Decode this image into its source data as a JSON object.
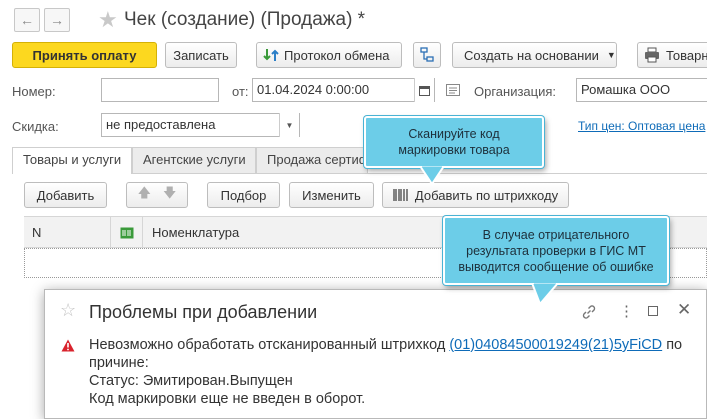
{
  "window": {
    "title": "Чек (создание) (Продажа) *"
  },
  "toolbar": {
    "accept_payment": "Принять оплату",
    "save": "Записать",
    "exchange_protocol": "Протокол обмена",
    "create_based_on": "Создать на основании",
    "goods_label": "Товарн"
  },
  "form": {
    "number_label": "Номер:",
    "number_value": "",
    "from_label": "от:",
    "date_value": "01.04.2024  0:00:00",
    "org_label": "Организация:",
    "org_value": "Ромашка ООО",
    "discount_label": "Скидка:",
    "discount_value": "не предоставлена",
    "price_type_link": "Тип цен: Оптовая цена"
  },
  "tabs": [
    {
      "label": "Товары и услуги"
    },
    {
      "label": "Агентские услуги"
    },
    {
      "label": "Продажа сертиф"
    }
  ],
  "table_toolbar": {
    "add": "Добавить",
    "pick": "Подбор",
    "edit": "Изменить",
    "add_by_barcode": "Добавить по штрихкоду"
  },
  "table": {
    "columns": [
      "N",
      "",
      "Номенклатура"
    ]
  },
  "tooltips": {
    "scan": "Сканируйте код маркировки товара",
    "error": "В случае отрицательного результата проверки в ГИС МТ выводится сообщение об ошибке"
  },
  "dialog": {
    "title": "Проблемы при добавлении",
    "message_prefix": "Невозможно обработать отсканированный штрихкод",
    "barcode": "(01)04084500019249(21)5yFiCD",
    "message_suffix": "по",
    "line_reason": "причине:",
    "line_status": "Статус: Эмитирован.Выпущен",
    "line_code": "Код маркировки еще не введен в оборот."
  },
  "colors": {
    "primary_button": "#fcd81f",
    "tooltip": "#6ccde8",
    "link": "#0e6bb8",
    "error_icon": "#d9232d"
  }
}
